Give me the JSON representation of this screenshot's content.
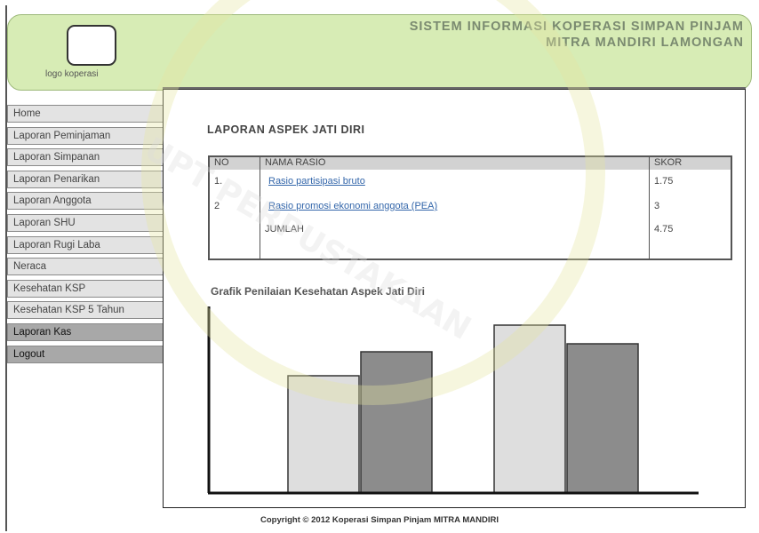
{
  "header": {
    "logo_label": "logo koperasi",
    "title_line1": "SISTEM INFORMASI KOPERASI SIMPAN PINJAM",
    "title_line2": "MITRA MANDIRI LAMONGAN"
  },
  "sidebar": {
    "items": [
      {
        "label": "Home"
      },
      {
        "label": "Laporan Peminjaman"
      },
      {
        "label": "Laporan Simpanan"
      },
      {
        "label": "Laporan Penarikan"
      },
      {
        "label": "Laporan Anggota"
      },
      {
        "label": "Laporan SHU"
      },
      {
        "label": "Laporan Rugi Laba"
      },
      {
        "label": "Neraca"
      },
      {
        "label": "Kesehatan KSP"
      },
      {
        "label": "Kesehatan KSP 5 Tahun"
      },
      {
        "label": "Laporan Kas"
      },
      {
        "label": "Logout"
      }
    ]
  },
  "main": {
    "report_title": "LAPORAN ASPEK JATI DIRI",
    "table": {
      "columns": [
        "NO",
        "NAMA RASIO",
        "SKOR"
      ],
      "rows": [
        {
          "no": "1.",
          "name": "Rasio partisipasi bruto",
          "score": "1.75"
        },
        {
          "no": "2",
          "name": "Rasio promosi ekonomi anggota (PEA)",
          "score": "3"
        },
        {
          "no": "",
          "name": "JUMLAH",
          "score": "4.75"
        }
      ]
    },
    "chart_title": "Grafik Penilaian Kesehatan Aspek Jati Diri"
  },
  "chart_data": {
    "type": "bar",
    "title": "Grafik Penilaian Kesehatan Aspek Jati Diri",
    "categories": [
      "",
      ""
    ],
    "series": [
      {
        "values": [
          44,
          63
        ]
      },
      {
        "values": [
          53,
          56
        ]
      }
    ],
    "ylim": [
      0,
      70
    ],
    "colors": [
      "#dedede",
      "#8c8c8c"
    ],
    "grid": false
  },
  "footer": {
    "copyright": "Copyright © 2012 Koperasi Simpan Pinjam MITRA MANDIRI"
  }
}
